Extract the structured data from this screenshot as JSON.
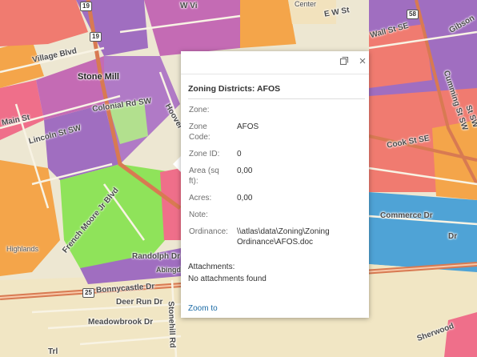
{
  "map": {
    "place_labels": [
      "Stone Mill",
      "Highlands"
    ],
    "street_labels": [
      "Village Blvd",
      "Colonial Rd SW",
      "Main St",
      "Lincoln St SW",
      "Hoover",
      "French Moore Jr Blvd",
      "Randolph Dr",
      "Bonnycastle Dr",
      "Deer Run Dr",
      "Meadowbrook Dr",
      "Stonehill Rd",
      "Cumming St SW",
      "Wall St SE",
      "Gibson",
      "Cook St SE",
      "Commerce Dr",
      "Sherwood",
      "Abingdon",
      "St SW",
      "Center",
      "Trl",
      "W Vi",
      "E W St",
      "Dr"
    ],
    "route_shields": [
      "19",
      "19",
      "58",
      "25"
    ],
    "colors": {
      "orange": "#f4a54a",
      "pink": "#ef6f8a",
      "salmon": "#f07b70",
      "purple": "#a06ec0",
      "magenta": "#c46bb4",
      "blue": "#4fa3d6",
      "green": "#8fe35a",
      "lightgreen": "#b2e08e",
      "tan": "#f2e2bd",
      "sand": "#ede7d2",
      "road": "#f3ecd9",
      "highway": "#d87a52"
    }
  },
  "popup": {
    "title": "Zoning Districts: AFOS",
    "fields": [
      {
        "label": "Zone:",
        "value": ""
      },
      {
        "label": "Zone Code:",
        "value": "AFOS"
      },
      {
        "label": "Zone ID:",
        "value": "0"
      },
      {
        "label": "Area (sq ft):",
        "value": "0,00"
      },
      {
        "label": "Acres:",
        "value": "0,00"
      },
      {
        "label": "Note:",
        "value": ""
      },
      {
        "label": "Ordinance:",
        "value": "\\\\atlas\\data\\Zoning\\Zoning Ordinance\\AFOS.doc"
      }
    ],
    "attachments_label": "Attachments:",
    "attachments_value": "No attachments found",
    "zoom_label": "Zoom to",
    "maximize_icon": "maximize-icon",
    "close_icon": "close-icon",
    "close_glyph": "×"
  }
}
